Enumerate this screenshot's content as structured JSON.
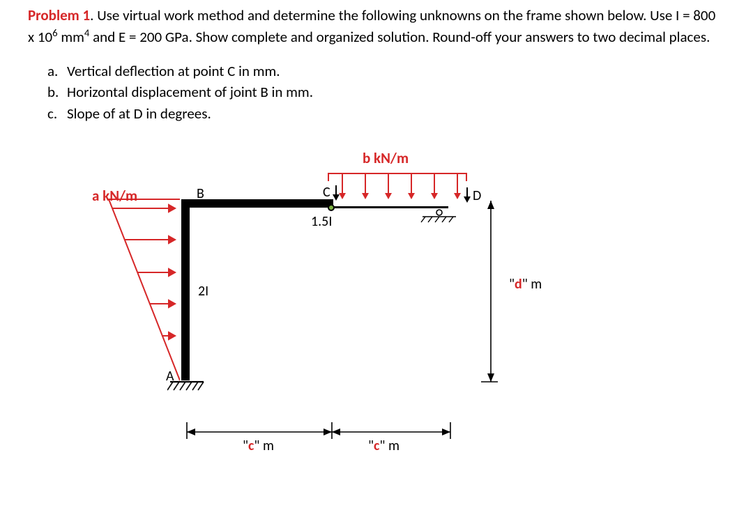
{
  "title": "Problem 1",
  "intro_part1": ". Use virtual work method and determine the following unknowns on the frame shown below. Use I = 800 x 10",
  "intro_sup": "6",
  "intro_unit_sup": "4",
  "intro_part2": " mm",
  "intro_part3": " and E = 200 GPa. Show complete and organized solution. Round-off your answers to two decimal places.",
  "questions": {
    "a": "Vertical deflection at point C in mm.",
    "b": "Horizontal displacement of joint B in mm.",
    "c": "Slope of at D in degrees."
  },
  "loads": {
    "a_label": "a kN/m",
    "b_label": "b kN/m"
  },
  "points": {
    "A": "A",
    "B": "B",
    "C": "C",
    "D": "D"
  },
  "member_labels": {
    "col": "2I",
    "beam": "1.5I"
  },
  "dims": {
    "c1": "\"c\" m",
    "c2": "\"c\" m",
    "d": "\"d\" m"
  }
}
